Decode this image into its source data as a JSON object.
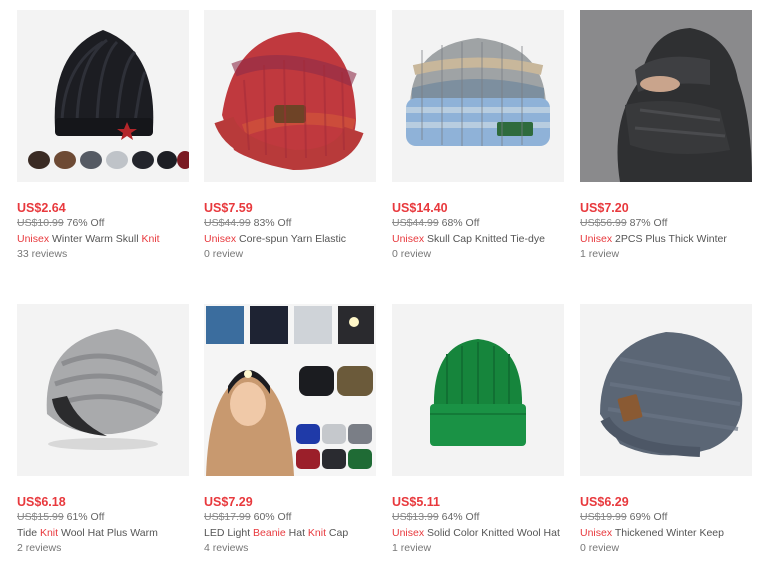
{
  "colors": {
    "accent": "#e8393d"
  },
  "products": [
    {
      "image": "black-knit-beanie-photo",
      "price": "US$2.64",
      "original_price": "US$10.99",
      "discount": "76% Off",
      "title_parts": [
        {
          "text": "Unisex",
          "highlight": true
        },
        {
          "text": " Winter Warm Skull ",
          "highlight": false
        },
        {
          "text": "Knit",
          "highlight": true
        }
      ],
      "reviews": "33 reviews"
    },
    {
      "image": "red-tie-dye-beanie-photo",
      "price": "US$7.59",
      "original_price": "US$44.99",
      "discount": "83% Off",
      "title_parts": [
        {
          "text": "Unisex",
          "highlight": true
        },
        {
          "text": " Core-spun Yarn Elastic",
          "highlight": false
        }
      ],
      "reviews": "0 review"
    },
    {
      "image": "blue-gradient-skull-cap-photo",
      "price": "US$14.40",
      "original_price": "US$44.99",
      "discount": "68% Off",
      "title_parts": [
        {
          "text": "Unisex",
          "highlight": true
        },
        {
          "text": " Skull Cap Knitted Tie-dye",
          "highlight": false
        }
      ],
      "reviews": "0 review"
    },
    {
      "image": "black-balaclava-photo",
      "price": "US$7.20",
      "original_price": "US$56.99",
      "discount": "87% Off",
      "title_parts": [
        {
          "text": "Unisex",
          "highlight": true
        },
        {
          "text": " 2PCS Plus Thick Winter",
          "highlight": false
        }
      ],
      "reviews": "1 review"
    },
    {
      "image": "grey-slouchy-beanie-photo",
      "price": "US$6.18",
      "original_price": "US$15.99",
      "discount": "61% Off",
      "title_parts": [
        {
          "text": "Tide ",
          "highlight": false
        },
        {
          "text": "Knit",
          "highlight": true
        },
        {
          "text": " Wool Hat Plus Warm",
          "highlight": false
        }
      ],
      "reviews": "2 reviews"
    },
    {
      "image": "led-light-beanie-collage-photo",
      "price": "US$7.29",
      "original_price": "US$17.99",
      "discount": "60% Off",
      "title_parts": [
        {
          "text": "LED Light ",
          "highlight": false
        },
        {
          "text": "Beanie",
          "highlight": true
        },
        {
          "text": " Hat ",
          "highlight": false
        },
        {
          "text": "Knit",
          "highlight": true
        },
        {
          "text": " Cap",
          "highlight": false
        }
      ],
      "reviews": "4 reviews"
    },
    {
      "image": "green-cuffed-beanie-photo",
      "price": "US$5.11",
      "original_price": "US$13.99",
      "discount": "64% Off",
      "title_parts": [
        {
          "text": "Unisex",
          "highlight": true
        },
        {
          "text": " Solid Color Knitted Wool Hat",
          "highlight": false
        }
      ],
      "reviews": "1 review"
    },
    {
      "image": "blue-grey-slouch-beanie-photo",
      "price": "US$6.29",
      "original_price": "US$19.99",
      "discount": "69% Off",
      "title_parts": [
        {
          "text": "Unisex",
          "highlight": true
        },
        {
          "text": " Thickened Winter Keep",
          "highlight": false
        }
      ],
      "reviews": "0 review"
    }
  ]
}
